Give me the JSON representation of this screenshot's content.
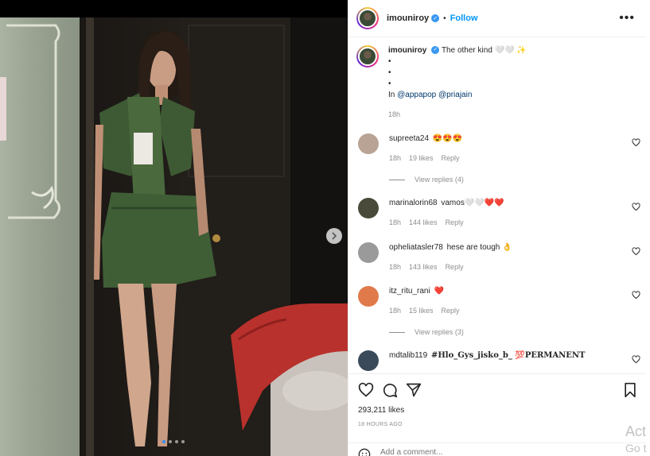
{
  "post": {
    "username": "imouniroy",
    "follow_label": "Follow",
    "separator": "•",
    "more_label": "•••"
  },
  "caption": {
    "username": "imouniroy",
    "text": "The other kind 🤍🤍 ✨",
    "bullets": [
      "•",
      "•",
      "•"
    ],
    "credit_prefix": "In",
    "mentions": [
      "@appapop",
      "@priajain"
    ],
    "time": "18h"
  },
  "comments": [
    {
      "user": "supreeta24",
      "text": "😍😍😍",
      "time": "18h",
      "likes": "19 likes",
      "reply": "Reply",
      "view_replies": "View replies (4)",
      "avatar_color": "#b9a394"
    },
    {
      "user": "marinalorin68",
      "text": "vamos🤍🤍❤️❤️",
      "time": "18h",
      "likes": "144 likes",
      "reply": "Reply",
      "avatar_color": "#4a4a3a"
    },
    {
      "user": "opheliatasler78",
      "text": "hese are tough 👌",
      "time": "18h",
      "likes": "143 likes",
      "reply": "Reply",
      "avatar_color": "#9a9a9a"
    },
    {
      "user": "itz_ritu_rani",
      "text": "❤️",
      "time": "18h",
      "likes": "15 likes",
      "reply": "Reply",
      "view_replies": "View replies (3)",
      "avatar_color": "#e07a4a"
    },
    {
      "user": "mdtalib119",
      "text": "#Hlo_Gys_jisko_b_ 💯PERMANENT",
      "avatar_color": "#3a4a5a"
    }
  ],
  "footer": {
    "likes": "293,211 likes",
    "time_ago": "18 HOURS AGO",
    "add_comment_placeholder": "Add a comment..."
  },
  "carousel": {
    "dot_count": 4,
    "active_dot": 0
  },
  "watermark": {
    "line1": "Act",
    "line2": "Go t"
  },
  "colors": {
    "accent_blue": "#0095f6",
    "verified_blue": "#3897f0",
    "text": "#262626",
    "muted": "#8e8e8e"
  },
  "icons": {
    "like": "heart-icon",
    "comment": "comment-bubble-icon",
    "share": "paper-plane-icon",
    "save": "bookmark-icon",
    "next": "chevron-right-icon",
    "emoji": "smiley-icon"
  }
}
